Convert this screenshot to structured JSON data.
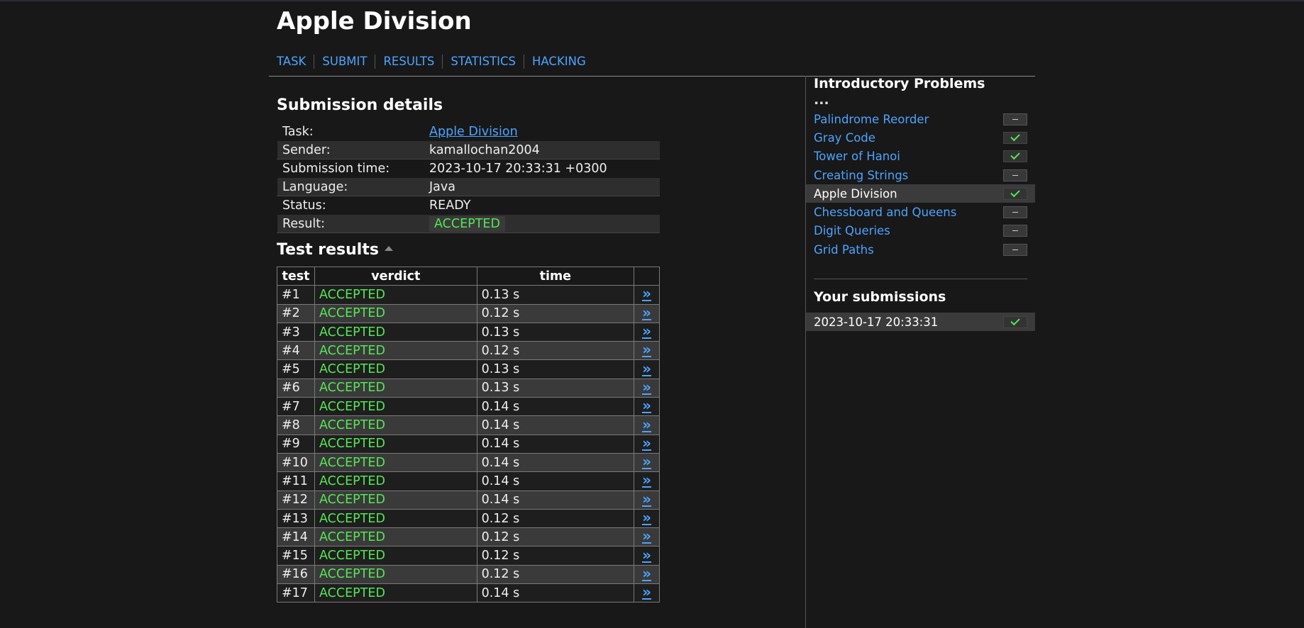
{
  "page_title": "Apple Division",
  "nav": [
    "TASK",
    "SUBMIT",
    "RESULTS",
    "STATISTICS",
    "HACKING"
  ],
  "details": {
    "heading": "Submission details",
    "rows": [
      {
        "key": "Task:",
        "value": "Apple Division"
      },
      {
        "key": "Sender:",
        "value": "kamallochan2004"
      },
      {
        "key": "Submission time:",
        "value": "2023-10-17 20:33:31 +0300"
      },
      {
        "key": "Language:",
        "value": "Java"
      },
      {
        "key": "Status:",
        "value": "READY"
      },
      {
        "key": "Result:",
        "value": "ACCEPTED"
      }
    ]
  },
  "tests": {
    "heading": "Test results",
    "columns": [
      "test",
      "verdict",
      "time",
      ""
    ],
    "rows": [
      {
        "test": "#1",
        "verdict": "ACCEPTED",
        "time": "0.13 s"
      },
      {
        "test": "#2",
        "verdict": "ACCEPTED",
        "time": "0.12 s"
      },
      {
        "test": "#3",
        "verdict": "ACCEPTED",
        "time": "0.13 s"
      },
      {
        "test": "#4",
        "verdict": "ACCEPTED",
        "time": "0.12 s"
      },
      {
        "test": "#5",
        "verdict": "ACCEPTED",
        "time": "0.13 s"
      },
      {
        "test": "#6",
        "verdict": "ACCEPTED",
        "time": "0.13 s"
      },
      {
        "test": "#7",
        "verdict": "ACCEPTED",
        "time": "0.14 s"
      },
      {
        "test": "#8",
        "verdict": "ACCEPTED",
        "time": "0.14 s"
      },
      {
        "test": "#9",
        "verdict": "ACCEPTED",
        "time": "0.14 s"
      },
      {
        "test": "#10",
        "verdict": "ACCEPTED",
        "time": "0.14 s"
      },
      {
        "test": "#11",
        "verdict": "ACCEPTED",
        "time": "0.14 s"
      },
      {
        "test": "#12",
        "verdict": "ACCEPTED",
        "time": "0.14 s"
      },
      {
        "test": "#13",
        "verdict": "ACCEPTED",
        "time": "0.12 s"
      },
      {
        "test": "#14",
        "verdict": "ACCEPTED",
        "time": "0.12 s"
      },
      {
        "test": "#15",
        "verdict": "ACCEPTED",
        "time": "0.12 s"
      },
      {
        "test": "#16",
        "verdict": "ACCEPTED",
        "time": "0.12 s"
      },
      {
        "test": "#17",
        "verdict": "ACCEPTED",
        "time": "0.14 s"
      }
    ],
    "arrow_glyph": "»",
    "arrow_icon": "double-chevron-right-icon"
  },
  "sidebar": {
    "section_title": "Introductory Problems",
    "ellipsis": "...",
    "tasks": [
      {
        "name": "Palindrome Reorder",
        "status": "none"
      },
      {
        "name": "Gray Code",
        "status": "done"
      },
      {
        "name": "Tower of Hanoi",
        "status": "done"
      },
      {
        "name": "Creating Strings",
        "status": "none"
      },
      {
        "name": "Apple Division",
        "status": "done",
        "current": true
      },
      {
        "name": "Chessboard and Queens",
        "status": "none"
      },
      {
        "name": "Digit Queries",
        "status": "none"
      },
      {
        "name": "Grid Paths",
        "status": "none"
      }
    ],
    "submissions_title": "Your submissions",
    "submissions": [
      {
        "time": "2023-10-17 20:33:31",
        "status": "done"
      }
    ]
  },
  "colors": {
    "background": "#181818",
    "link": "#4da3ff",
    "accepted": "#55e655",
    "row_alt": "#3a3a3a"
  }
}
